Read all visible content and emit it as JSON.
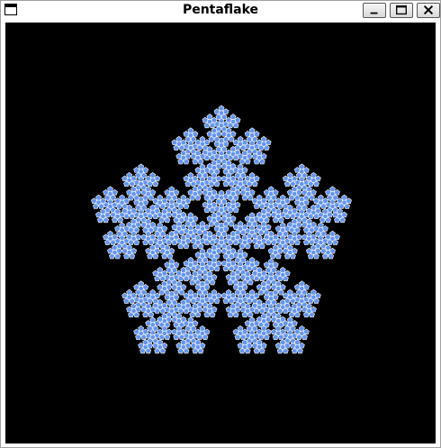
{
  "window": {
    "title": "Pentaflake",
    "buttons": {
      "minimize": "minimize",
      "maximize": "maximize",
      "close": "close"
    }
  },
  "canvas": {
    "background": "#000000",
    "fill_color": "#6495ed",
    "outline_color": "#ffffff",
    "recursion_depth": 4
  }
}
